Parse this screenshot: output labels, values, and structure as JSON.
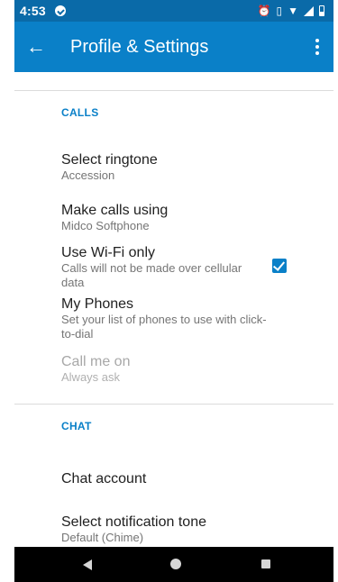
{
  "status_bar": {
    "time": "4:53",
    "icons": [
      "app-notification-icon",
      "alarm-icon",
      "vibrate-icon",
      "wifi-icon",
      "signal-icon",
      "battery-icon"
    ]
  },
  "app_bar": {
    "back_icon": "arrow-left-icon",
    "title": "Profile & Settings",
    "menu_icon": "more-vert-icon"
  },
  "sections": {
    "calls": {
      "header": "CALLS",
      "select_ringtone": {
        "title": "Select ringtone",
        "summary": "Accession"
      },
      "make_calls_using": {
        "title": "Make calls using",
        "summary": "Midco Softphone"
      },
      "use_wifi_only": {
        "title": "Use Wi-Fi only",
        "summary": "Calls will not be made over cellular data",
        "checked": true
      },
      "my_phones": {
        "title": "My Phones",
        "summary": "Set your list of phones to use with click-to-dial"
      },
      "call_me_on": {
        "title": "Call me on",
        "summary": "Always ask",
        "enabled": false
      }
    },
    "chat": {
      "header": "CHAT",
      "chat_account": {
        "title": "Chat account"
      },
      "notification_tone": {
        "title": "Select notification tone",
        "summary": "Default (Chime)"
      }
    }
  },
  "colors": {
    "status_bar": "#0a6aa8",
    "app_bar": "#0a80c8",
    "accent": "#0a80c8",
    "nav_bar": "#000000"
  }
}
